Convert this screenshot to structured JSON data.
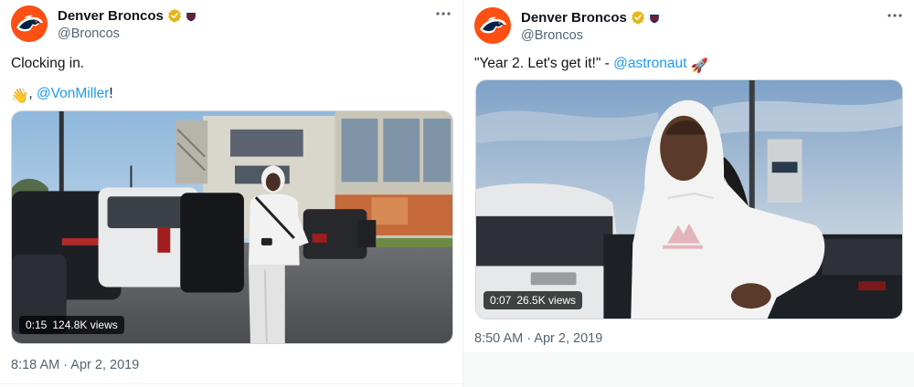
{
  "colors": {
    "brand_orange": "#fb4f14",
    "brand_navy": "#002244",
    "link": "#1d9bf0",
    "secondary_text": "#536471",
    "verified_gold": "#e2b719"
  },
  "icons": {
    "verified": "gold-verified-badge-icon",
    "affiliation": "nfl-shield-icon",
    "more": "more-dots-icon",
    "avatar": "broncos-horse-logo"
  },
  "tweets": [
    {
      "author": {
        "name": "Denver Broncos",
        "handle": "@Broncos"
      },
      "text_line1": "Clocking in.",
      "wave_emoji": "👋",
      "text_sep": ", ",
      "mention": "@VonMiller",
      "text_end": "!",
      "video": {
        "duration": "0:15",
        "views": "124.8K views"
      },
      "timestamp": "8:18 AM · Apr 2, 2019"
    },
    {
      "author": {
        "name": "Denver Broncos",
        "handle": "@Broncos"
      },
      "quote_text": "\"Year 2. Let's get it!\" - ",
      "mention": "@astronaut",
      "rocket_emoji": "🚀",
      "video": {
        "duration": "0:07",
        "views": "26.5K views"
      },
      "timestamp": "8:50 AM · Apr 2, 2019"
    }
  ]
}
